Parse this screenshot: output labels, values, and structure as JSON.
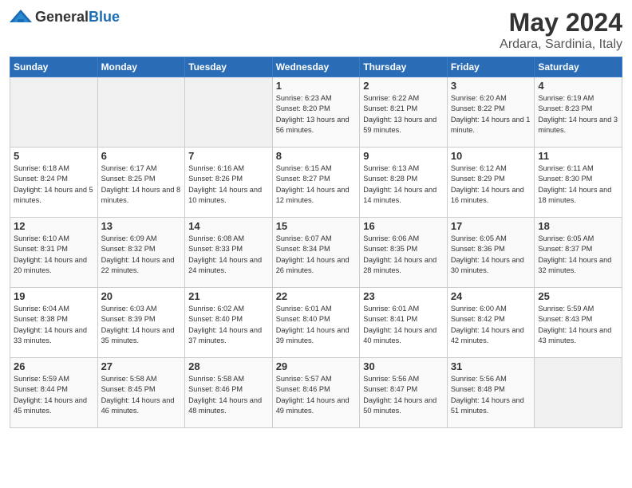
{
  "header": {
    "logo_general": "General",
    "logo_blue": "Blue",
    "month": "May 2024",
    "location": "Ardara, Sardinia, Italy"
  },
  "days_of_week": [
    "Sunday",
    "Monday",
    "Tuesday",
    "Wednesday",
    "Thursday",
    "Friday",
    "Saturday"
  ],
  "weeks": [
    [
      {
        "day": "",
        "info": ""
      },
      {
        "day": "",
        "info": ""
      },
      {
        "day": "",
        "info": ""
      },
      {
        "day": "1",
        "info": "Sunrise: 6:23 AM\nSunset: 8:20 PM\nDaylight: 13 hours and 56 minutes."
      },
      {
        "day": "2",
        "info": "Sunrise: 6:22 AM\nSunset: 8:21 PM\nDaylight: 13 hours and 59 minutes."
      },
      {
        "day": "3",
        "info": "Sunrise: 6:20 AM\nSunset: 8:22 PM\nDaylight: 14 hours and 1 minute."
      },
      {
        "day": "4",
        "info": "Sunrise: 6:19 AM\nSunset: 8:23 PM\nDaylight: 14 hours and 3 minutes."
      }
    ],
    [
      {
        "day": "5",
        "info": "Sunrise: 6:18 AM\nSunset: 8:24 PM\nDaylight: 14 hours and 5 minutes."
      },
      {
        "day": "6",
        "info": "Sunrise: 6:17 AM\nSunset: 8:25 PM\nDaylight: 14 hours and 8 minutes."
      },
      {
        "day": "7",
        "info": "Sunrise: 6:16 AM\nSunset: 8:26 PM\nDaylight: 14 hours and 10 minutes."
      },
      {
        "day": "8",
        "info": "Sunrise: 6:15 AM\nSunset: 8:27 PM\nDaylight: 14 hours and 12 minutes."
      },
      {
        "day": "9",
        "info": "Sunrise: 6:13 AM\nSunset: 8:28 PM\nDaylight: 14 hours and 14 minutes."
      },
      {
        "day": "10",
        "info": "Sunrise: 6:12 AM\nSunset: 8:29 PM\nDaylight: 14 hours and 16 minutes."
      },
      {
        "day": "11",
        "info": "Sunrise: 6:11 AM\nSunset: 8:30 PM\nDaylight: 14 hours and 18 minutes."
      }
    ],
    [
      {
        "day": "12",
        "info": "Sunrise: 6:10 AM\nSunset: 8:31 PM\nDaylight: 14 hours and 20 minutes."
      },
      {
        "day": "13",
        "info": "Sunrise: 6:09 AM\nSunset: 8:32 PM\nDaylight: 14 hours and 22 minutes."
      },
      {
        "day": "14",
        "info": "Sunrise: 6:08 AM\nSunset: 8:33 PM\nDaylight: 14 hours and 24 minutes."
      },
      {
        "day": "15",
        "info": "Sunrise: 6:07 AM\nSunset: 8:34 PM\nDaylight: 14 hours and 26 minutes."
      },
      {
        "day": "16",
        "info": "Sunrise: 6:06 AM\nSunset: 8:35 PM\nDaylight: 14 hours and 28 minutes."
      },
      {
        "day": "17",
        "info": "Sunrise: 6:05 AM\nSunset: 8:36 PM\nDaylight: 14 hours and 30 minutes."
      },
      {
        "day": "18",
        "info": "Sunrise: 6:05 AM\nSunset: 8:37 PM\nDaylight: 14 hours and 32 minutes."
      }
    ],
    [
      {
        "day": "19",
        "info": "Sunrise: 6:04 AM\nSunset: 8:38 PM\nDaylight: 14 hours and 33 minutes."
      },
      {
        "day": "20",
        "info": "Sunrise: 6:03 AM\nSunset: 8:39 PM\nDaylight: 14 hours and 35 minutes."
      },
      {
        "day": "21",
        "info": "Sunrise: 6:02 AM\nSunset: 8:40 PM\nDaylight: 14 hours and 37 minutes."
      },
      {
        "day": "22",
        "info": "Sunrise: 6:01 AM\nSunset: 8:40 PM\nDaylight: 14 hours and 39 minutes."
      },
      {
        "day": "23",
        "info": "Sunrise: 6:01 AM\nSunset: 8:41 PM\nDaylight: 14 hours and 40 minutes."
      },
      {
        "day": "24",
        "info": "Sunrise: 6:00 AM\nSunset: 8:42 PM\nDaylight: 14 hours and 42 minutes."
      },
      {
        "day": "25",
        "info": "Sunrise: 5:59 AM\nSunset: 8:43 PM\nDaylight: 14 hours and 43 minutes."
      }
    ],
    [
      {
        "day": "26",
        "info": "Sunrise: 5:59 AM\nSunset: 8:44 PM\nDaylight: 14 hours and 45 minutes."
      },
      {
        "day": "27",
        "info": "Sunrise: 5:58 AM\nSunset: 8:45 PM\nDaylight: 14 hours and 46 minutes."
      },
      {
        "day": "28",
        "info": "Sunrise: 5:58 AM\nSunset: 8:46 PM\nDaylight: 14 hours and 48 minutes."
      },
      {
        "day": "29",
        "info": "Sunrise: 5:57 AM\nSunset: 8:46 PM\nDaylight: 14 hours and 49 minutes."
      },
      {
        "day": "30",
        "info": "Sunrise: 5:56 AM\nSunset: 8:47 PM\nDaylight: 14 hours and 50 minutes."
      },
      {
        "day": "31",
        "info": "Sunrise: 5:56 AM\nSunset: 8:48 PM\nDaylight: 14 hours and 51 minutes."
      },
      {
        "day": "",
        "info": ""
      }
    ]
  ]
}
